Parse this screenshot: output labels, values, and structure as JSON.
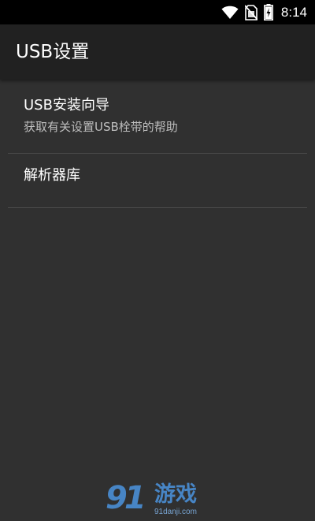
{
  "status_bar": {
    "time": "8:14",
    "icons": [
      "wifi-icon",
      "no-sim-icon",
      "battery-charging-icon"
    ]
  },
  "app_bar": {
    "title": "USB设置"
  },
  "preferences": [
    {
      "title": "USB安装向导",
      "summary": "获取有关设置USB栓带的帮助"
    },
    {
      "title": "解析器库"
    }
  ],
  "watermark": {
    "number": "91",
    "text": "游戏",
    "url": "91danji.com"
  },
  "colors": {
    "background": "#303030",
    "app_bar": "#212121",
    "status_bar": "#000000",
    "summary_text": "#bdbdbd",
    "divider": "#4a4a4a",
    "watermark": "#4a8fd6"
  }
}
